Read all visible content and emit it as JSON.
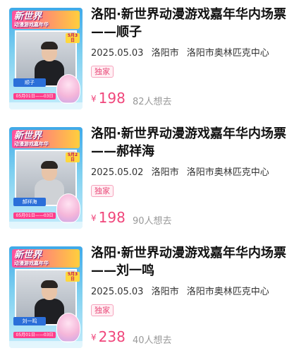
{
  "items": [
    {
      "title": "洛阳·新世界动漫游戏嘉年华内场票——顺子",
      "date": "2025.05.03",
      "city": "洛阳市",
      "venue": "洛阳市奥林匹克中心",
      "badge": "独家",
      "currency": "¥",
      "price": "198",
      "want": "82人想去",
      "poster": {
        "brand": "新世界",
        "brand_sub": "动漫游戏嘉年华",
        "name": "顺子",
        "tag": "5月3日",
        "dates": "05月01日——03日"
      }
    },
    {
      "title": "洛阳·新世界动漫游戏嘉年华内场票——郝祥海",
      "date": "2025.05.02",
      "city": "洛阳市",
      "venue": "洛阳市奥林匹克中心",
      "badge": "独家",
      "currency": "¥",
      "price": "198",
      "want": "90人想去",
      "poster": {
        "brand": "新世界",
        "brand_sub": "动漫游戏嘉年华",
        "name": "郝祥海",
        "tag": "5月2日",
        "dates": "05月01日——03日"
      }
    },
    {
      "title": "洛阳·新世界动漫游戏嘉年华内场票——刘一鸣",
      "date": "2025.05.03",
      "city": "洛阳市",
      "venue": "洛阳市奥林匹克中心",
      "badge": "独家",
      "currency": "¥",
      "price": "238",
      "want": "40人想去",
      "poster": {
        "brand": "新世界",
        "brand_sub": "动漫游戏嘉年华",
        "name": "刘一鸣",
        "tag": "5月3日",
        "dates": "05月01日——03日"
      }
    }
  ]
}
